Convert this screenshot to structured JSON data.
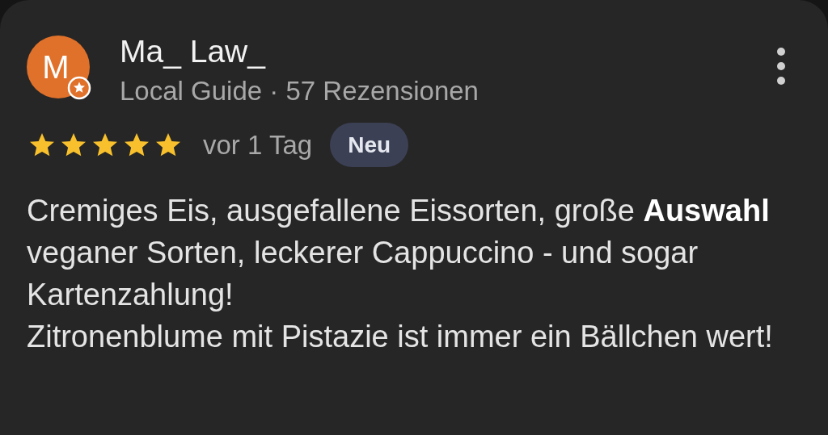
{
  "review": {
    "author": {
      "initial": "M",
      "name": "Ma_ Law_",
      "local_guide": true,
      "subtitle": "Local Guide · 57 Rezensionen"
    },
    "stars": 5,
    "date": "vor 1 Tag",
    "badge": "Neu",
    "paragraphs": [
      "Cremiges Eis, ausgefallene Eissorten, große **Auswahl** veganer Sorten, leckerer Cappuccino - und sogar Kartenzahlung!",
      "Zitronenblume mit Pistazie ist immer ein Bällchen wert!"
    ]
  }
}
